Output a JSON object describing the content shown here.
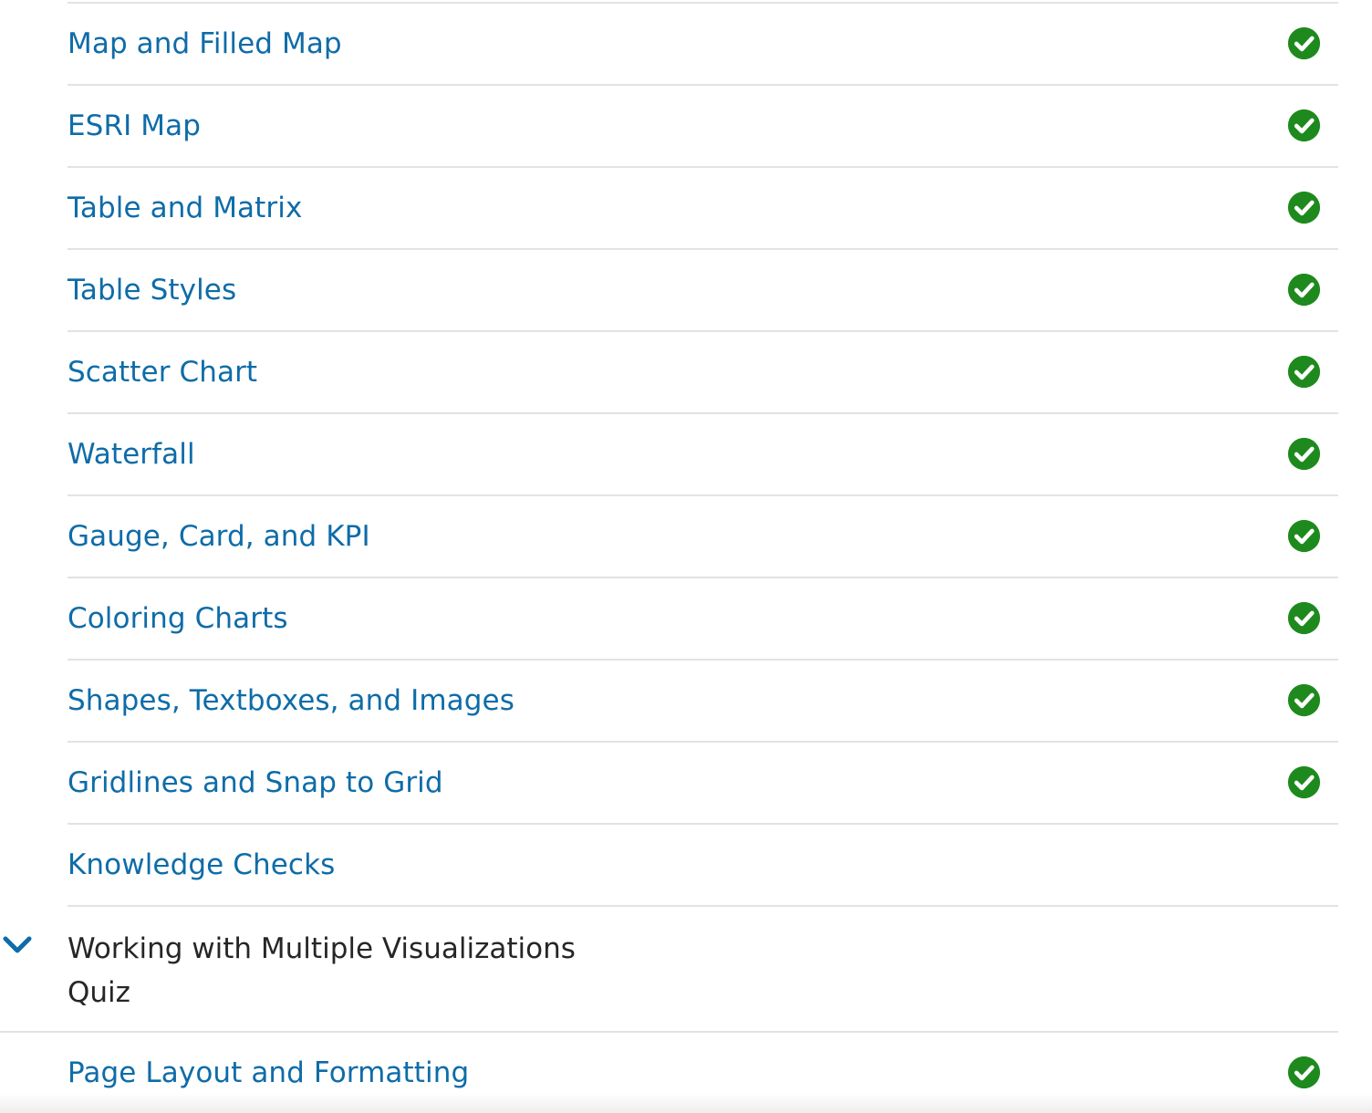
{
  "lessons_before": [
    {
      "label": "Map and Filled Map",
      "completed": true
    },
    {
      "label": "ESRI Map",
      "completed": true
    },
    {
      "label": "Table and Matrix",
      "completed": true
    },
    {
      "label": "Table Styles",
      "completed": true
    },
    {
      "label": "Scatter Chart",
      "completed": true
    },
    {
      "label": "Waterfall",
      "completed": true
    },
    {
      "label": "Gauge, Card, and KPI",
      "completed": true
    },
    {
      "label": "Coloring Charts",
      "completed": true
    },
    {
      "label": "Shapes, Textboxes, and Images",
      "completed": true
    },
    {
      "label": "Gridlines and Snap to Grid",
      "completed": true
    },
    {
      "label": "Knowledge Checks",
      "completed": false
    }
  ],
  "section": {
    "title_line1": "Working with Multiple Visualizations",
    "title_line2": "Quiz",
    "expanded": true
  },
  "lessons_after": [
    {
      "label": "Page Layout and Formatting",
      "completed": true
    }
  ],
  "colors": {
    "link": "#0e6ca8",
    "check": "#1e8a1e",
    "divider": "#e3e3e3",
    "section_text": "#262626"
  },
  "icons": {
    "completed": "check-circle-icon",
    "expand": "chevron-down-icon"
  }
}
